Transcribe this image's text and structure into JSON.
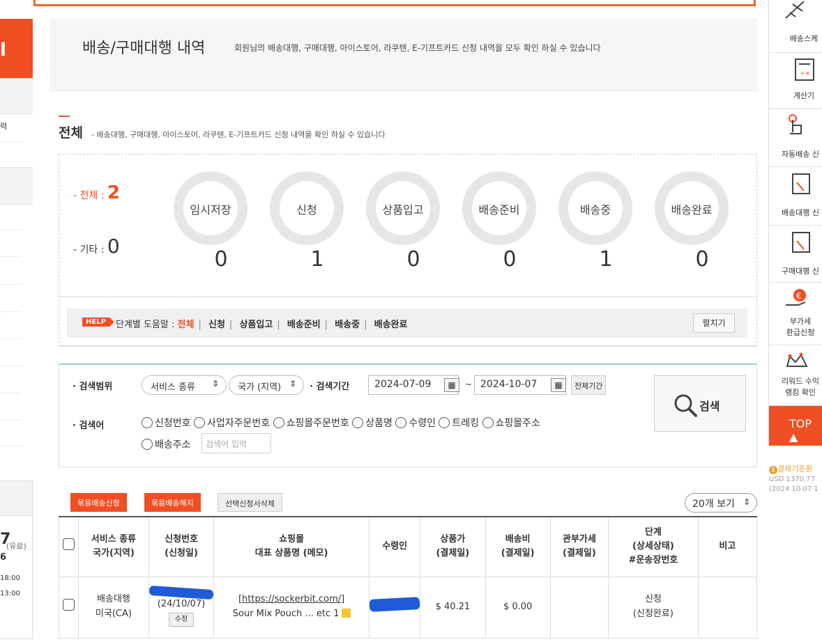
{
  "header": {
    "title": "배송/구매대행 내역",
    "subtitle": "회원님의 배송대행, 구매대행, 아이스토어, 라쿠텐, E-기프트카드 신청 내역을 모두 확인 하실 수 있습니다"
  },
  "section": {
    "title": "전체",
    "subtitle": "- 배송대행, 구매대행, 아이스토어, 라쿠텐, E-기프트카드 신청 내역을 확인 하실 수 있습니다"
  },
  "summary": {
    "total_label": "- 전체 : ",
    "total_value": "2",
    "etc_label": "- 기타 : ",
    "etc_value": "0"
  },
  "stages": [
    {
      "label": "임시저장",
      "count": "0"
    },
    {
      "label": "신청",
      "count": "1"
    },
    {
      "label": "상품입고",
      "count": "0"
    },
    {
      "label": "배송준비",
      "count": "0"
    },
    {
      "label": "배송중",
      "count": "1"
    },
    {
      "label": "배송완료",
      "count": "0"
    }
  ],
  "help": {
    "badge": "HELP",
    "prefix": "단계별 도움말 : ",
    "links": [
      "전체",
      "신청",
      "상품입고",
      "배송준비",
      "배송중",
      "배송완료"
    ],
    "expand_label": "펼치기"
  },
  "search": {
    "range_label": "· 검색범위",
    "service_select": "서비스 종류",
    "country_select": "국가 (지역)",
    "period_label": "· 검색기간",
    "date_from": "2024-07-09",
    "tilde": "~",
    "date_to": "2024-10-07",
    "all_period_label": "전체기간",
    "keyword_label": "· 검색어",
    "options": [
      "신청번호",
      "사업자주문번호",
      "쇼핑몰주문번호",
      "상품명",
      "수령인",
      "트레킹",
      "쇼핑몰주소",
      "배송주소"
    ],
    "keyword_placeholder": "검색어 입력",
    "search_button": "검색"
  },
  "actions": {
    "bundle_request": "묶음배송신청",
    "bundle_cancel": "묶음배송해지",
    "delete_selected": "선택신청서삭제",
    "per_page": "20개 보기"
  },
  "table": {
    "headers": [
      [
        "서비스 종류",
        "국가(지역)"
      ],
      [
        "신청번호",
        "(신청일)"
      ],
      [
        "쇼핑몰",
        "대표 상품명 (메모)"
      ],
      [
        "수령인"
      ],
      [
        "상품가",
        "(결제일)"
      ],
      [
        "배송비",
        "(결제일)"
      ],
      [
        "관부가세",
        "(결제일)"
      ],
      [
        "단계",
        "(상세상태)",
        "#운송장번호"
      ],
      [
        "비고"
      ]
    ],
    "rows": [
      {
        "service": "배송대행",
        "country": "미국(CA)",
        "order_date": "(24/10/07)",
        "edit_label": "수정",
        "mall_url": "[https://sockerbit.com/]",
        "product": "Sour Mix Pouch ... etc 1",
        "price": "$ 40.21",
        "shipping": "$ 0.00",
        "tax": "",
        "stage": "신청",
        "stage_detail": "(신청완료)",
        "note": ""
      }
    ]
  },
  "right_sidebar": {
    "items": [
      "배송스케",
      "계산기",
      "자동배송 신",
      "배송대행 신",
      "구매대행 신",
      "부가세",
      "환급신청",
      "리워드 수익",
      "랭킹 확인"
    ],
    "top_label": "TOP",
    "rate_title": "결제기준환",
    "rate_value": "USD 1370.77",
    "rate_date": "(2024.10.07 1"
  },
  "left_sidebar": {
    "header_glyph": "l",
    "text1": "력",
    "fee_suffix": "(유료)",
    "num_big": "7",
    "num2": "6",
    "time1": "18:00",
    "time2": "13:00"
  },
  "colors": {
    "accent": "#f04e23",
    "search_border": "#9fd1c0"
  }
}
